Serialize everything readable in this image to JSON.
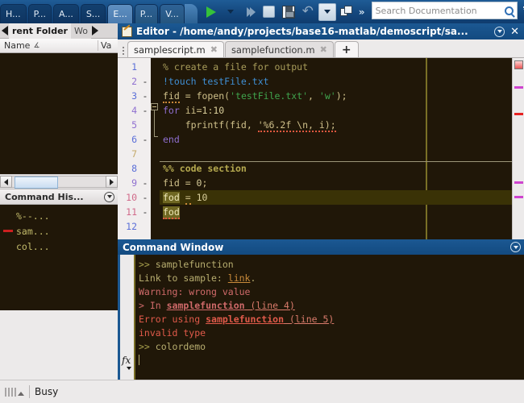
{
  "ribbon": {
    "tabs": [
      {
        "label": "H...",
        "name": "home",
        "state": "normal"
      },
      {
        "label": "P...",
        "name": "plots",
        "state": "normal"
      },
      {
        "label": "A...",
        "name": "apps",
        "state": "normal"
      },
      {
        "label": "S...",
        "name": "shortcuts",
        "state": "normal"
      },
      {
        "label": "E...",
        "name": "editor",
        "state": "active"
      },
      {
        "label": "P...",
        "name": "publish",
        "state": "semi"
      },
      {
        "label": "V...",
        "name": "view",
        "state": "semi"
      }
    ],
    "toolbar": [
      {
        "name": "run-button",
        "icon": "play-icon",
        "enabled": true
      },
      {
        "name": "run-options-dropdown",
        "icon": "chevron-down-icon",
        "enabled": true
      },
      {
        "name": "run-and-advance-button",
        "icon": "double-chevron-right-icon",
        "enabled": false
      },
      {
        "name": "stop-button",
        "icon": "stop-square-icon",
        "enabled": false
      },
      {
        "name": "save-button",
        "icon": "floppy-disk-icon",
        "enabled": true
      },
      {
        "name": "undo-button",
        "icon": "undo-arrow-icon",
        "enabled": false
      },
      {
        "name": "undo-history-dropdown",
        "icon": "chevron-down-icon",
        "enabled": true
      },
      {
        "name": "layout-button",
        "icon": "windows-layout-icon",
        "enabled": true
      },
      {
        "name": "overflow-button",
        "icon": "double-chevron-right-icon",
        "enabled": true
      }
    ],
    "search": {
      "placeholder": "Search Documentation",
      "value": "",
      "icon": "search-icon"
    },
    "minimize_icon": "collapse-ribbon-icon"
  },
  "left": {
    "tabs": [
      {
        "label": "rent Folder",
        "name": "current-folder",
        "active": true
      },
      {
        "label": "Wo",
        "name": "workspace",
        "active": false
      }
    ],
    "scroll_left_icon": "arrow-left-icon",
    "scroll_right_icon": "arrow-right-icon",
    "table": {
      "columns": [
        "Name",
        "Va"
      ],
      "sort_indicator": "∡",
      "rows": []
    },
    "hscroll": {
      "left_icon": "arrow-left-icon",
      "right_icon": "arrow-right-icon"
    },
    "history": {
      "title": "Command His...",
      "dropdown_icon": "panel-options-icon",
      "rows": [
        {
          "marker": false,
          "text": "%--..."
        },
        {
          "marker": true,
          "text": "sam..."
        },
        {
          "marker": false,
          "text": "col..."
        }
      ]
    }
  },
  "editor": {
    "title": "Editor - /home/andy/projects/base16-matlab/demoscript/sa...",
    "app_icon": "editor-pencil-icon",
    "dropdown_icon": "panel-options-icon",
    "close_icon": "close-icon",
    "tabs": [
      {
        "label": "samplescript.m",
        "active": true,
        "close_icon": "close-tab-icon"
      },
      {
        "label": "samplefunction.m",
        "active": false,
        "close_icon": "close-tab-icon"
      },
      {
        "label": "+",
        "active": false,
        "is_new": true
      }
    ],
    "lines": [
      {
        "num": "1",
        "breakpoint": "",
        "color": "#5b6fd8"
      },
      {
        "num": "2",
        "breakpoint": "-",
        "color": "#8f6fd0"
      },
      {
        "num": "3",
        "breakpoint": "-",
        "color": "#5b6fd8"
      },
      {
        "num": "4",
        "breakpoint": "-",
        "color": "#8f6fd0"
      },
      {
        "num": "5",
        "breakpoint": "",
        "color": "#8f6fd0"
      },
      {
        "num": "6",
        "breakpoint": "-",
        "color": "#5b6fd8"
      },
      {
        "num": "7",
        "breakpoint": "",
        "color": "#c4a96a"
      },
      {
        "num": "8",
        "breakpoint": "",
        "color": "#5b6fd8"
      },
      {
        "num": "9",
        "breakpoint": "-",
        "color": "#8f6fd0"
      },
      {
        "num": "10",
        "breakpoint": "-",
        "color": "#d06a8a"
      },
      {
        "num": "11",
        "breakpoint": "-",
        "color": "#d06a8a"
      },
      {
        "num": "12",
        "breakpoint": "",
        "color": "#5b6fd8"
      }
    ],
    "code": [
      "% create a file for output",
      "!touch testFile.txt",
      "fid = fopen('testFile.txt', 'w');",
      "for ii=1:10",
      "    fprintf(fid, '%6.2f \\n, i);",
      "end",
      "",
      "%% code section",
      "fid = 0;",
      "fod = 10",
      "fod",
      ""
    ],
    "current_line": 10,
    "selection": "fod",
    "health_indicator": "code-analyzer-status",
    "markers": [
      "warning",
      "error",
      "warning",
      "warning"
    ]
  },
  "command_window": {
    "title": "Command Window",
    "dropdown_icon": "panel-options-icon",
    "fx_icon": "function-browser-icon",
    "lines": [
      {
        "prompt": ">>",
        "text": " samplefunction",
        "kind": "command"
      },
      {
        "text": "Link to sample: ",
        "link": "link",
        "suffix": ".",
        "kind": "normal"
      },
      {
        "text": "Warning: wrong value",
        "kind": "warning"
      },
      {
        "prefix": "> In ",
        "fn": "samplefunction",
        "ref": " (line 4)",
        "kind": "stack"
      },
      {
        "prefix": "Error using ",
        "fn": "samplefunction",
        "ref": " (line 5)",
        "kind": "error"
      },
      {
        "text": "invalid type",
        "kind": "error"
      },
      {
        "prompt": ">>",
        "text": " colordemo",
        "kind": "command"
      },
      {
        "text": "",
        "kind": "caret"
      }
    ]
  },
  "status_bar": {
    "resize_icon": "resize-grip-icon",
    "text": "Busy"
  }
}
